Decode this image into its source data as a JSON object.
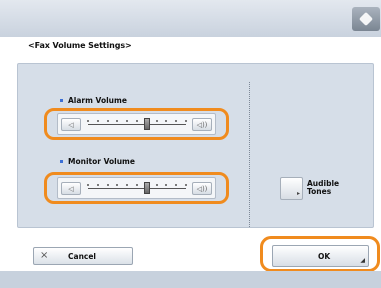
{
  "screen": {
    "title": "<Fax Volume Settings>"
  },
  "alarm": {
    "label": "Alarm Volume",
    "level": 6,
    "steps": 10
  },
  "monitor": {
    "label": "Monitor Volume",
    "level": 6,
    "steps": 10
  },
  "controls": {
    "decrease_glyph": "◁",
    "increase_glyph": "◁))"
  },
  "audible": {
    "line1": "Audible",
    "line2": "Tones"
  },
  "footer": {
    "cancel_label": "Cancel",
    "cancel_glyph": "×",
    "ok_label": "OK"
  },
  "colors": {
    "highlight": "#f08b1e",
    "panel": "#d6dee8"
  },
  "icons": {
    "top_right": "printer-cube-icon"
  }
}
